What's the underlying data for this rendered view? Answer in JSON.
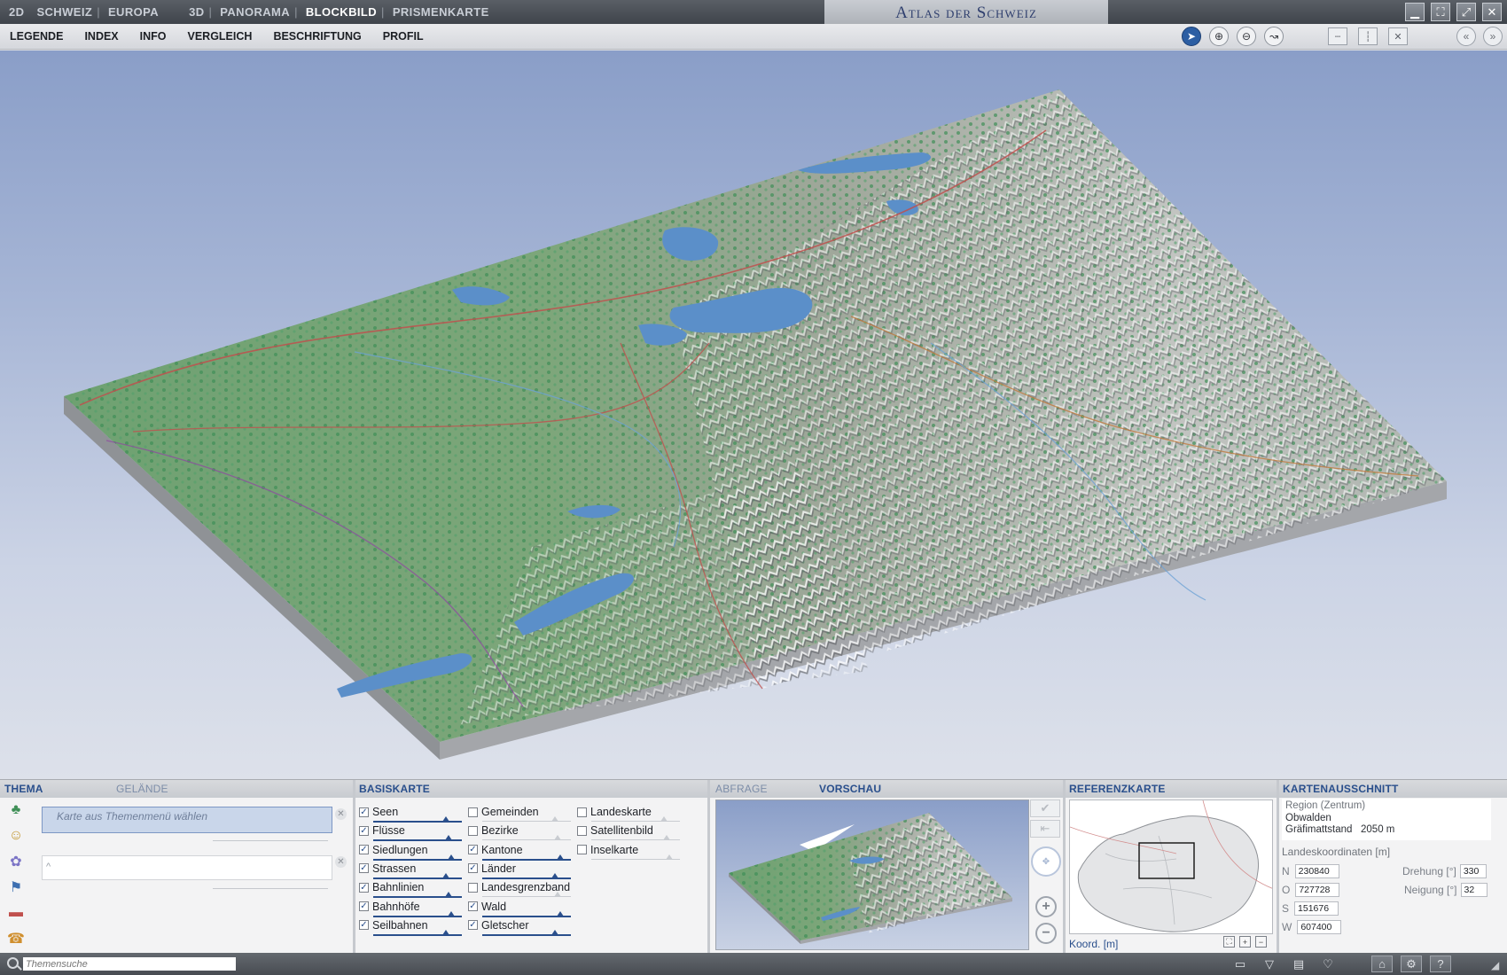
{
  "topbar": {
    "modes": [
      "2D",
      "SCHWEIZ",
      "EUROPA",
      "3D",
      "PANORAMA",
      "BLOCKBILD",
      "PRISMENKARTE"
    ],
    "active_mode": "BLOCKBILD",
    "title": "Atlas der Schweiz"
  },
  "menu": [
    "LEGENDE",
    "INDEX",
    "INFO",
    "VERGLEICH",
    "BESCHRIFTUNG",
    "PROFIL"
  ],
  "tools": [
    "pointer-icon",
    "zoom-in-icon",
    "zoom-out-icon",
    "measure-icon"
  ],
  "thema": {
    "tab_active": "THEMA",
    "tab_inactive": "GELÄNDE",
    "select_placeholder": "Karte aus Themenmenü wählen",
    "icons": [
      "forest-icon",
      "population-icon",
      "economy-icon",
      "politics-icon",
      "transport-icon",
      "communication-icon"
    ]
  },
  "basiskarte": {
    "title": "BASISKARTE",
    "col1": [
      {
        "label": "Seen",
        "checked": true
      },
      {
        "label": "Flüsse",
        "checked": true
      },
      {
        "label": "Siedlungen",
        "checked": true
      },
      {
        "label": "Strassen",
        "checked": true
      },
      {
        "label": "Bahnlinien",
        "checked": true
      },
      {
        "label": "Bahnhöfe",
        "checked": true
      },
      {
        "label": "Seilbahnen",
        "checked": true
      }
    ],
    "col2": [
      {
        "label": "Gemeinden",
        "checked": false
      },
      {
        "label": "Bezirke",
        "checked": false
      },
      {
        "label": "Kantone",
        "checked": true
      },
      {
        "label": "Länder",
        "checked": true
      },
      {
        "label": "Landesgrenzband",
        "checked": false
      },
      {
        "label": "Wald",
        "checked": true
      },
      {
        "label": "Gletscher",
        "checked": true
      }
    ],
    "col3": [
      {
        "label": "Landeskarte",
        "checked": false
      },
      {
        "label": "Satellitenbild",
        "checked": false
      },
      {
        "label": "Inselkarte",
        "checked": false
      }
    ]
  },
  "vorschau": {
    "tab_inactive": "ABFRAGE",
    "tab_active": "VORSCHAU"
  },
  "referenzkarte": {
    "title": "REFERENZKARTE",
    "koord_label": "Koord. [m]"
  },
  "kartenausschnitt": {
    "title": "KARTENAUSSCHNITT",
    "region": "Region (Zentrum)",
    "canton": "Obwalden",
    "station": "Gräfimattstand",
    "elevation": "2050 m",
    "coords_title": "Landeskoordinaten [m]",
    "coords": [
      {
        "label": "N",
        "value": "230840"
      },
      {
        "label": "O",
        "value": "727728"
      },
      {
        "label": "S",
        "value": "151676"
      },
      {
        "label": "W",
        "value": "607400"
      }
    ],
    "drehung_label": "Drehung [°]",
    "drehung": "330",
    "neigung_label": "Neigung [°]",
    "neigung": "32"
  },
  "statusbar": {
    "search_placeholder": "Themensuche"
  },
  "colors": {
    "accent": "#2a4f8c",
    "lake": "#5b8fc9",
    "forest": "#4f9a64",
    "terrain": "#b7b8b3"
  }
}
